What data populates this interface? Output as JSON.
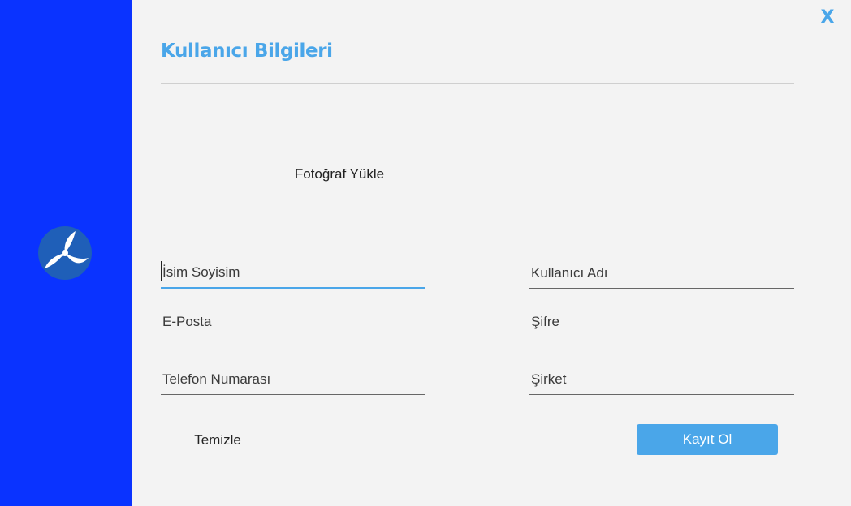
{
  "window": {
    "close_label": "X"
  },
  "header": {
    "title": "Kullanıcı Bilgileri"
  },
  "photo": {
    "upload_label": "Fotoğraf Yükle"
  },
  "form": {
    "full_name": {
      "placeholder": "İsim Soyisim",
      "value": ""
    },
    "username": {
      "placeholder": "Kullanıcı Adı",
      "value": ""
    },
    "email": {
      "placeholder": "E-Posta",
      "value": ""
    },
    "password": {
      "placeholder": "Şifre",
      "value": ""
    },
    "phone": {
      "placeholder": "Telefon Numarası",
      "value": ""
    },
    "company": {
      "placeholder": "Şirket",
      "value": ""
    }
  },
  "actions": {
    "clear_label": "Temizle",
    "register_label": "Kayıt Ol"
  },
  "colors": {
    "sidebar": "#0a33ff",
    "accent": "#4aa6e9",
    "background": "#f3f3f3",
    "logo": "#1f5fb8"
  },
  "icons": {
    "logo": "app-logo-icon",
    "close": "close-icon"
  }
}
